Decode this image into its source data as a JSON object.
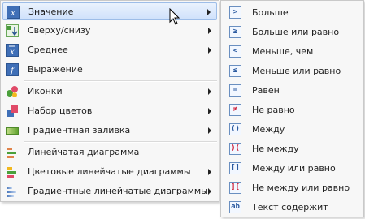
{
  "main_menu": {
    "items": [
      {
        "label": "Значение",
        "icon": "x-variable-icon",
        "has_submenu": true
      },
      {
        "label": "Сверху/снизу",
        "icon": "top-bottom-icon",
        "has_submenu": true
      },
      {
        "label": "Среднее",
        "icon": "x-average-icon",
        "has_submenu": true
      },
      {
        "label": "Выражение",
        "icon": "function-icon",
        "has_submenu": false
      },
      {
        "label": "Иконки",
        "icon": "icons-icon",
        "has_submenu": true
      },
      {
        "label": "Набор цветов",
        "icon": "color-set-icon",
        "has_submenu": true
      },
      {
        "label": "Градиентная заливка",
        "icon": "gradient-fill-icon",
        "has_submenu": true
      },
      {
        "label": "Линейчатая диаграмма",
        "icon": "bar-chart-icon",
        "has_submenu": false
      },
      {
        "label": "Цветовые линейчатые диаграммы",
        "icon": "color-bar-chart-icon",
        "has_submenu": true
      },
      {
        "label": "Градиентные линейчатые диаграммы",
        "icon": "gradient-bar-chart-icon",
        "has_submenu": true
      }
    ]
  },
  "sub_menu": {
    "items": [
      {
        "label": "Больше",
        "symbol": ">"
      },
      {
        "label": "Больше или равно",
        "symbol": "≥"
      },
      {
        "label": "Меньше, чем",
        "symbol": "<"
      },
      {
        "label": "Меньше или равно",
        "symbol": "≤"
      },
      {
        "label": "Равен",
        "symbol": "="
      },
      {
        "label": "Не равно",
        "symbol": "≠"
      },
      {
        "label": "Между",
        "symbol": "()"
      },
      {
        "label": "Не между",
        "symbol": ")("
      },
      {
        "label": "Между или равно",
        "symbol": "[]"
      },
      {
        "label": "Не между или равно",
        "symbol": "]["
      },
      {
        "label": "Текст содержит",
        "symbol": "ab"
      }
    ]
  },
  "colors": {
    "highlight_border": "#9dbde8",
    "highlight_fill": "#cfe1fb",
    "menu_bg": "#f7f7f7"
  }
}
